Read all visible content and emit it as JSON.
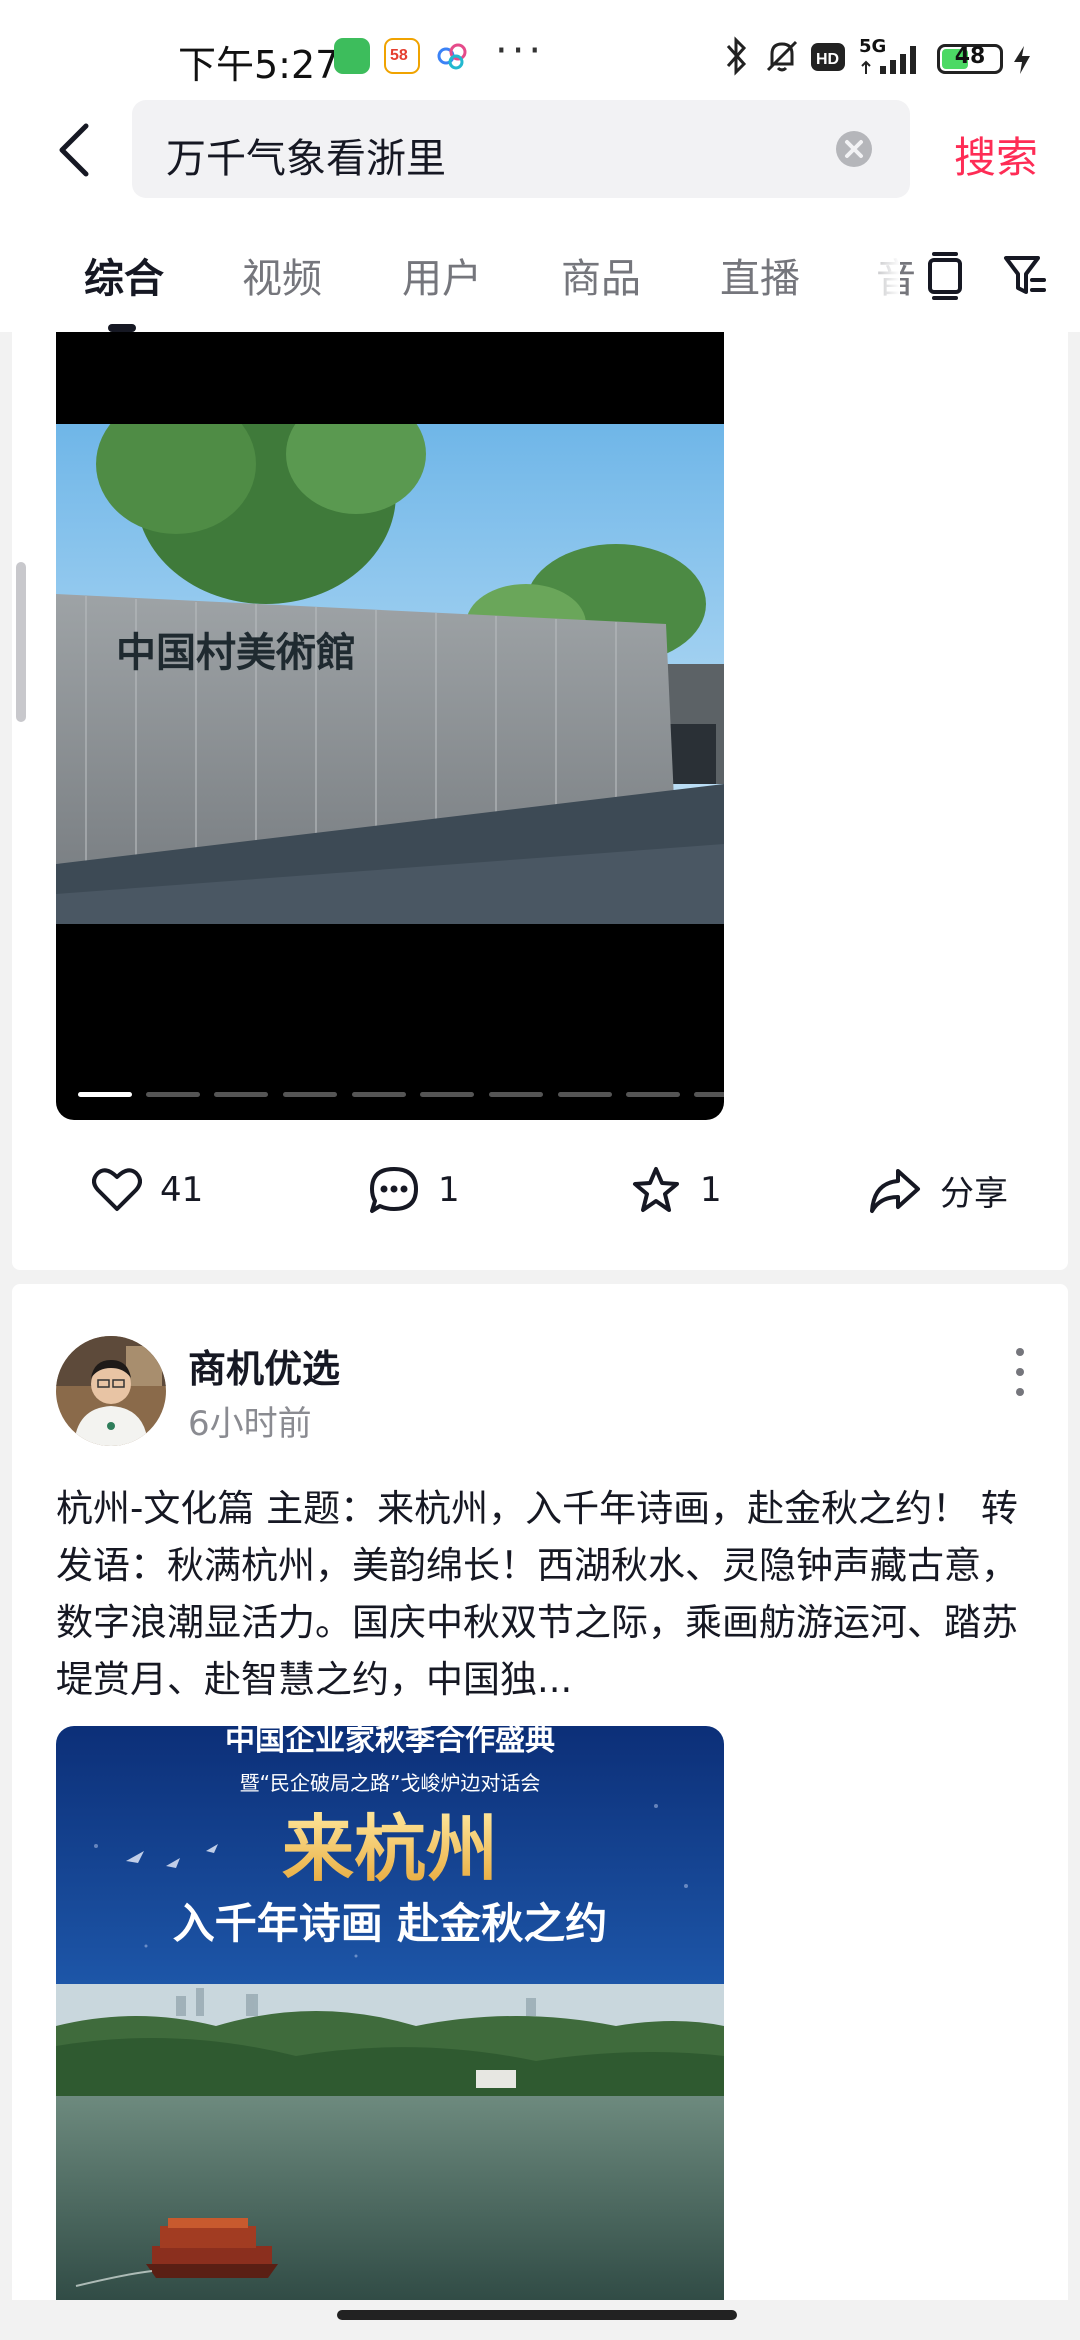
{
  "status_bar": {
    "time": "下午5:27",
    "network": "5G",
    "battery": "48",
    "battery_level": 0.48
  },
  "search": {
    "query": "万千气象看浙里",
    "submit_label": "搜索"
  },
  "tabs": [
    {
      "label": "综合",
      "active": true
    },
    {
      "label": "视频",
      "active": false
    },
    {
      "label": "用户",
      "active": false
    },
    {
      "label": "商品",
      "active": false
    },
    {
      "label": "直播",
      "active": false
    },
    {
      "label": "音",
      "active": false
    }
  ],
  "post1": {
    "image_sign_text": "中国村美術館",
    "pager_total": 10,
    "pager_current": 1,
    "likes": "41",
    "comments": "1",
    "favorites": "1",
    "share_label": "分享"
  },
  "post2": {
    "author": "商机优选",
    "time": "6小时前",
    "caption": "杭州-文化篇 主题：来杭州，入千年诗画，赴金秋之约！ 转发语：秋满杭州，美韵绵长！西湖秋水、灵隐钟声藏古意，数字浪潮显活力。国庆中秋双节之际，乘画舫游运河、踏苏堤赏月、赴智慧之约，中国独...",
    "poster": {
      "line1": "中国企业家秋季合作盛典",
      "line2": "暨“民企破局之路”戈峻炉边对话会",
      "line3": "来杭州",
      "line4": "入千年诗画 赴金秋之约"
    }
  },
  "colors": {
    "accent": "#fe2c55",
    "text_primary": "#161823",
    "text_secondary": "#8a8b91"
  }
}
